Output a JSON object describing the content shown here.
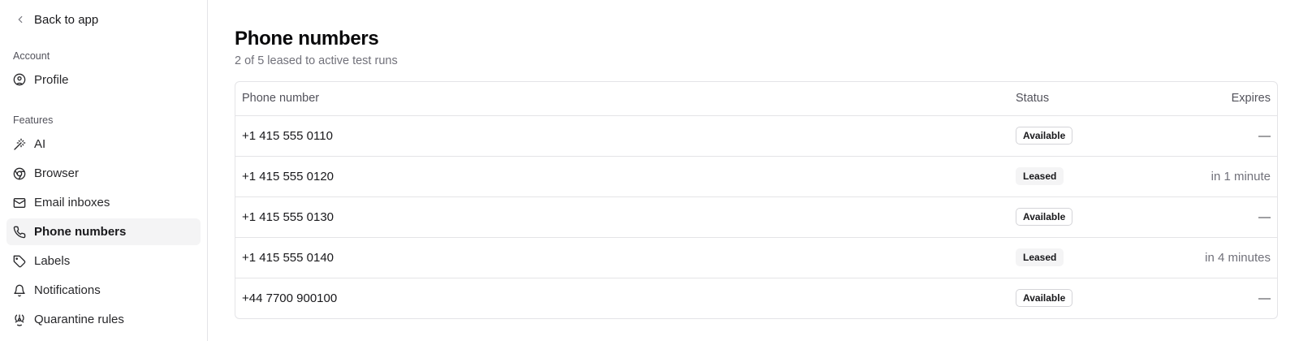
{
  "sidebar": {
    "back_label": "Back to app",
    "account_label": "Account",
    "account_items": [
      {
        "label": "Profile",
        "icon": "user-circle-icon"
      }
    ],
    "features_label": "Features",
    "feature_items": [
      {
        "label": "AI",
        "icon": "magic-wand-icon"
      },
      {
        "label": "Browser",
        "icon": "chrome-icon"
      },
      {
        "label": "Email inboxes",
        "icon": "mail-icon"
      },
      {
        "label": "Phone numbers",
        "icon": "phone-icon",
        "active": true
      },
      {
        "label": "Labels",
        "icon": "tag-icon"
      },
      {
        "label": "Notifications",
        "icon": "bell-icon"
      },
      {
        "label": "Quarantine rules",
        "icon": "biohazard-icon"
      }
    ]
  },
  "main": {
    "title": "Phone numbers",
    "subtitle": "2 of 5 leased to active test runs",
    "table": {
      "headers": {
        "phone": "Phone number",
        "status": "Status",
        "expires": "Expires"
      },
      "rows": [
        {
          "phone": "+1 415 555 0110",
          "status": "Available",
          "expires": "—"
        },
        {
          "phone": "+1 415 555 0120",
          "status": "Leased",
          "expires": "in 1 minute"
        },
        {
          "phone": "+1 415 555 0130",
          "status": "Available",
          "expires": "—"
        },
        {
          "phone": "+1 415 555 0140",
          "status": "Leased",
          "expires": "in 4 minutes"
        },
        {
          "phone": "+44 7700 900100",
          "status": "Available",
          "expires": "—"
        }
      ]
    }
  },
  "colors": {
    "border": "#e4e4e7",
    "active_bg": "#f4f4f5",
    "muted_text": "#71717a"
  }
}
